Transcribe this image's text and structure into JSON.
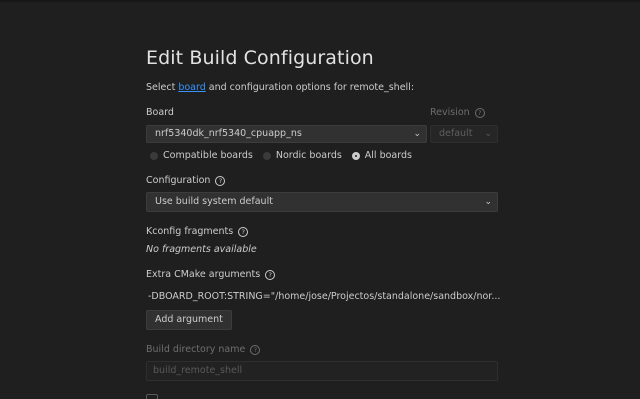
{
  "page": {
    "title": "Edit Build Configuration",
    "subtitle_before": "Select ",
    "subtitle_link": "board",
    "subtitle_after": " and configuration options for remote_shell:"
  },
  "board": {
    "label": "Board",
    "value": "nrf5340dk_nrf5340_cpuapp_ns",
    "revision_label": "Revision",
    "revision_value": "default",
    "filters": [
      {
        "label": "Compatible boards",
        "selected": false
      },
      {
        "label": "Nordic boards",
        "selected": false
      },
      {
        "label": "All boards",
        "selected": true
      }
    ]
  },
  "configuration": {
    "label": "Configuration",
    "value": "Use build system default"
  },
  "kconfig": {
    "label": "Kconfig fragments",
    "empty_text": "No fragments available"
  },
  "cmake": {
    "label": "Extra CMake arguments",
    "argument": "-DBOARD_ROOT:STRING=\"/home/jose/Projectos/standalone/sandbox/nor...",
    "add_button": "Add argument"
  },
  "build_dir": {
    "label": "Build directory name",
    "placeholder": "build_remote_shell"
  },
  "colors": {
    "background": "#1f1f1f",
    "link": "#3794ff",
    "text": "#cccccc"
  }
}
